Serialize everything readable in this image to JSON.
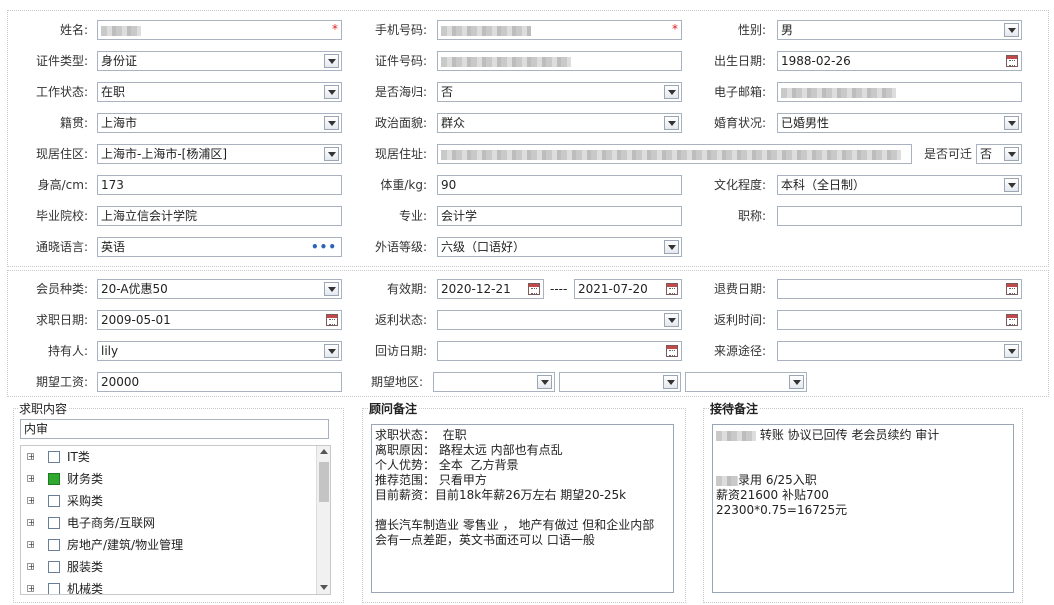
{
  "personal": {
    "name_label": "姓名:",
    "phone_label": "手机号码:",
    "gender_label": "性别:",
    "gender_value": "男",
    "idtype_label": "证件类型:",
    "idtype_value": "身份证",
    "idnum_label": "证件号码:",
    "birth_label": "出生日期:",
    "birth_value": "1988-02-26",
    "work_label": "工作状态:",
    "work_value": "在职",
    "returnee_label": "是否海归:",
    "returnee_value": "否",
    "email_label": "电子邮箱:",
    "origin_label": "籍贯:",
    "origin_value": "上海市",
    "political_label": "政治面貌:",
    "political_value": "群众",
    "marital_label": "婚育状况:",
    "marital_value": "已婚男性",
    "area_label": "现居住区:",
    "area_value": "上海市-上海市-[杨浦区]",
    "address_label": "现居住址:",
    "relocate_label": "是否可迁",
    "relocate_value": "否",
    "height_label": "身高/cm:",
    "height_value": "173",
    "weight_label": "体重/kg:",
    "weight_value": "90",
    "edu_label": "文化程度:",
    "edu_value": "本科（全日制）",
    "school_label": "毕业院校:",
    "school_value": "上海立信会计学院",
    "major_label": "专业:",
    "major_value": "会计学",
    "title_label": "职称:",
    "title_value": "",
    "lang_label": "通晓语言:",
    "lang_value": "英语",
    "lang_button": "•••",
    "level_label": "外语等级:",
    "level_value": "六级（口语好）",
    "required_mark": "*"
  },
  "member": {
    "type_label": "会员种类:",
    "type_value": "20-A优惠50",
    "valid_label": "有效期:",
    "valid_from": "2020-12-21",
    "valid_sep": "----",
    "valid_to": "2021-07-20",
    "refund_date_label": "退费日期:",
    "seek_date_label": "求职日期:",
    "seek_date_value": "2009-05-01",
    "rebate_status_label": "返利状态:",
    "rebate_time_label": "返利时间:",
    "holder_label": "持有人:",
    "holder_value": "lily",
    "visit_label": "回访日期:",
    "source_label": "来源途径:",
    "salary_label": "期望工资:",
    "salary_value": "20000",
    "region_label": "期望地区:"
  },
  "job_content": {
    "legend": "求职内容",
    "search_value": "内审",
    "items": [
      {
        "label": "IT类",
        "checked": false
      },
      {
        "label": "财务类",
        "checked": true
      },
      {
        "label": "采购类",
        "checked": false
      },
      {
        "label": "电子商务/互联网",
        "checked": false
      },
      {
        "label": "房地产/建筑/物业管理",
        "checked": false
      },
      {
        "label": "服装类",
        "checked": false
      },
      {
        "label": "机械类",
        "checked": false
      }
    ]
  },
  "consultant_note": {
    "legend": "顾问备注",
    "text": "求职状态：  在职\n离职原因： 路程太远 内部也有点乱\n个人优势： 全本  乙方背景\n推荐范围： 只看甲方\n目前薪资：目前18k年薪26万左右 期望20-25k\n\n擅长汽车制造业 零售业 ， 地产有做过 但和企业内部\n会有一点差距，英文书面还可以 口语一般"
  },
  "reception_note": {
    "legend": "接待备注",
    "line1": " 转账 协议已回传 老会员续约 审计",
    "line2": "录用 6/25入职",
    "line3": "薪资21600  补贴700",
    "line4": "22300*0.75=16725元"
  }
}
